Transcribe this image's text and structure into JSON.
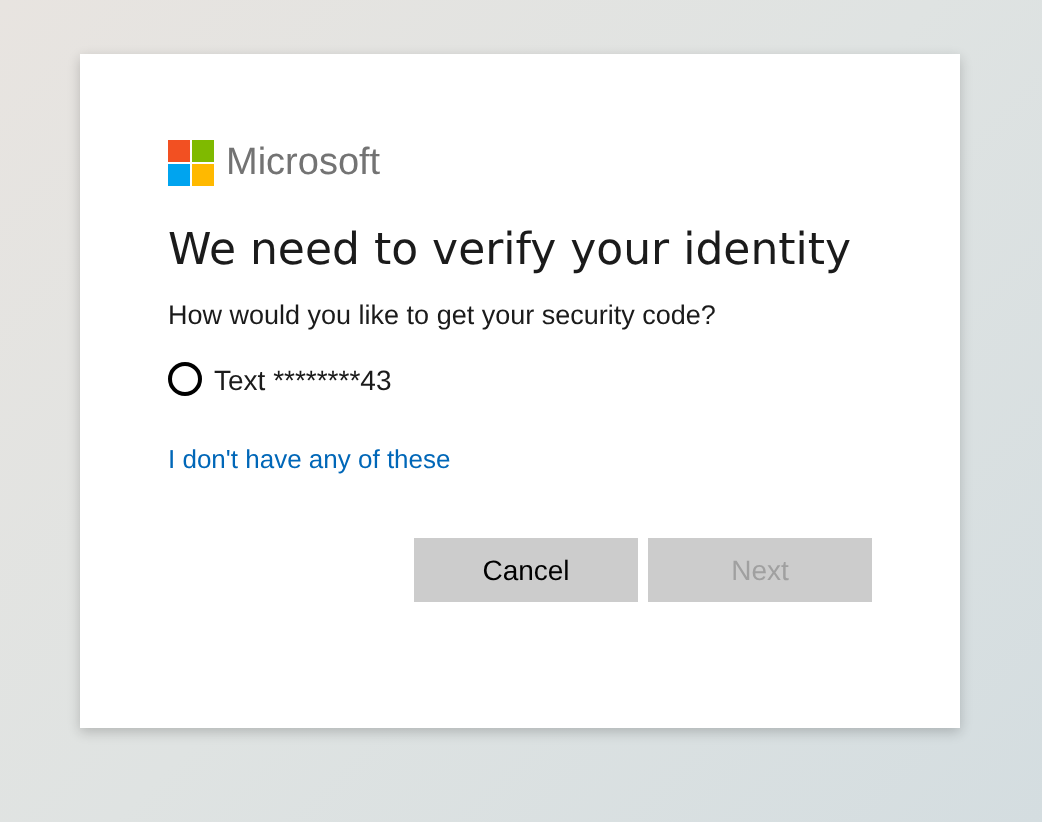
{
  "brand": "Microsoft",
  "title": "We need to verify your identity",
  "prompt": "How would you like to get your security code?",
  "options": [
    {
      "label": "Text ********43",
      "selected": false
    }
  ],
  "link": "I don't have any of these",
  "buttons": [
    {
      "label": "Cancel",
      "disabled": false
    },
    {
      "label": "Next",
      "disabled": true
    }
  ]
}
